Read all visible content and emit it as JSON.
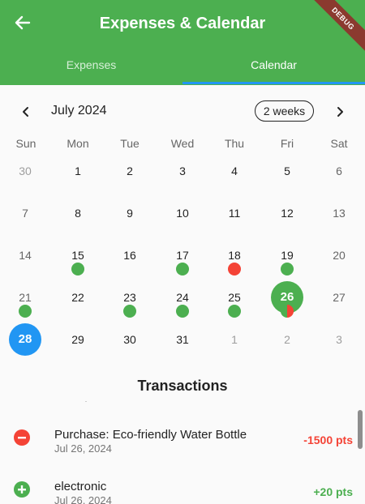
{
  "app": {
    "title": "Expenses & Calendar",
    "debug_label": "DEBUG",
    "tabs": [
      {
        "label": "Expenses",
        "active": false
      },
      {
        "label": "Calendar",
        "active": true
      }
    ],
    "colors": {
      "primary": "#4caf50",
      "accent": "#2196f3",
      "negative": "#f44336",
      "positive": "#4caf50"
    }
  },
  "calendar": {
    "month_label": "July 2024",
    "format_button": "2 weeks",
    "weekdays": [
      "Sun",
      "Mon",
      "Tue",
      "Wed",
      "Thu",
      "Fri",
      "Sat"
    ],
    "rows": [
      [
        "30",
        "1",
        "2",
        "3",
        "4",
        "5",
        "6"
      ],
      [
        "7",
        "8",
        "9",
        "10",
        "11",
        "12",
        "13"
      ],
      [
        "14",
        "15",
        "16",
        "17",
        "18",
        "19",
        "20"
      ],
      [
        "21",
        "22",
        "23",
        "24",
        "25",
        "26",
        "27"
      ],
      [
        "28",
        "29",
        "30",
        "31",
        "1",
        "2",
        "3"
      ]
    ],
    "selected_day": "26",
    "today_day": "28",
    "markers": {
      "15": "income",
      "17": "income",
      "18": "expense",
      "19": "income",
      "21": "income",
      "23": "income",
      "24": "income",
      "25": "income",
      "26": "mixed"
    }
  },
  "transactions": {
    "title": "Transactions",
    "items": [
      {
        "title": "Purchase: Eco-friendly Water Bottle",
        "date": "Jul 26, 2024",
        "amount": "-1500 pts",
        "type": "negative",
        "icon": "minus-circle-icon"
      },
      {
        "title": "electronic",
        "date": "Jul 26, 2024",
        "amount": "+20 pts",
        "type": "positive",
        "icon": "plus-circle-icon"
      }
    ]
  }
}
